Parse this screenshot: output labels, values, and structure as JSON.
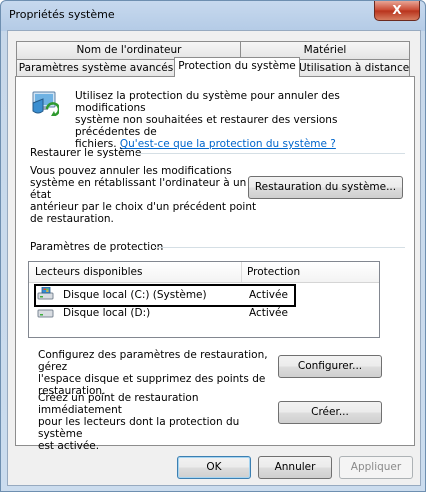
{
  "window": {
    "title": "Propriétés système",
    "close_label": "X"
  },
  "tabs_back": [
    {
      "label": "Nom de l'ordinateur"
    },
    {
      "label": "Matériel"
    }
  ],
  "tabs_front": [
    {
      "label": "Paramètres système avancés"
    },
    {
      "label": "Protection du système"
    },
    {
      "label": "Utilisation à distance"
    }
  ],
  "intro": {
    "line1": "Utilisez la protection du système pour annuler des modifications",
    "line2": "système non souhaitées et restaurer des versions précédentes de",
    "line3": "fichiers.",
    "link": "Qu'est-ce que la protection du système ?"
  },
  "restore": {
    "section_title": "Restaurer le système",
    "line1": "Vous pouvez annuler les modifications",
    "line2": "système en rétablissant l'ordinateur à un état",
    "line3": "antérieur par le choix d'un précédent point",
    "line4": "de restauration.",
    "button": "Restauration du système..."
  },
  "protection": {
    "section_title": "Paramètres de protection",
    "columns": [
      "Lecteurs disponibles",
      "Protection"
    ],
    "drives": [
      {
        "name": "Disque local (C:) (Système)",
        "status": "Activée",
        "icon": "system-drive-icon"
      },
      {
        "name": "Disque local (D:)",
        "status": "Activée",
        "icon": "hard-drive-icon"
      }
    ]
  },
  "configure": {
    "line1": "Configurez des paramètres de restauration, gérez",
    "line2": "l'espace disque et supprimez des points de",
    "line3": "restauration.",
    "button": "Configurer..."
  },
  "create": {
    "line1": "Créez un point de restauration immédiatement",
    "line2": "pour les lecteurs dont la protection du système",
    "line3": "est activée.",
    "button": "Créer..."
  },
  "footer": {
    "ok": "OK",
    "cancel": "Annuler",
    "apply": "Appliquer"
  }
}
